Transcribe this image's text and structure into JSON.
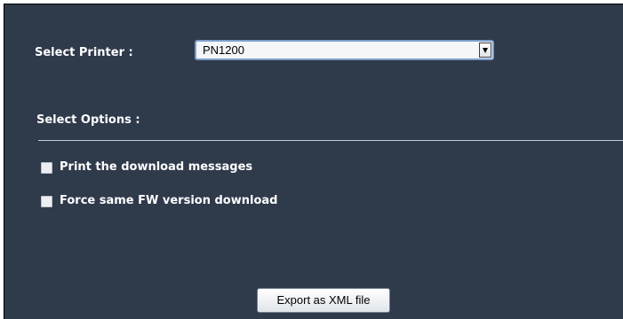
{
  "printer": {
    "label": "Select Printer :",
    "selected": "PN1200"
  },
  "options": {
    "label": "Select Options :",
    "items": [
      {
        "label": "Print the download messages",
        "checked": false
      },
      {
        "label": "Force same FW version download",
        "checked": false
      }
    ]
  },
  "actions": {
    "export_label": "Export as XML file"
  },
  "colors": {
    "panel_bg": "#2f3a4b",
    "text": "#ffffff",
    "select_border": "#7d9ec9"
  }
}
